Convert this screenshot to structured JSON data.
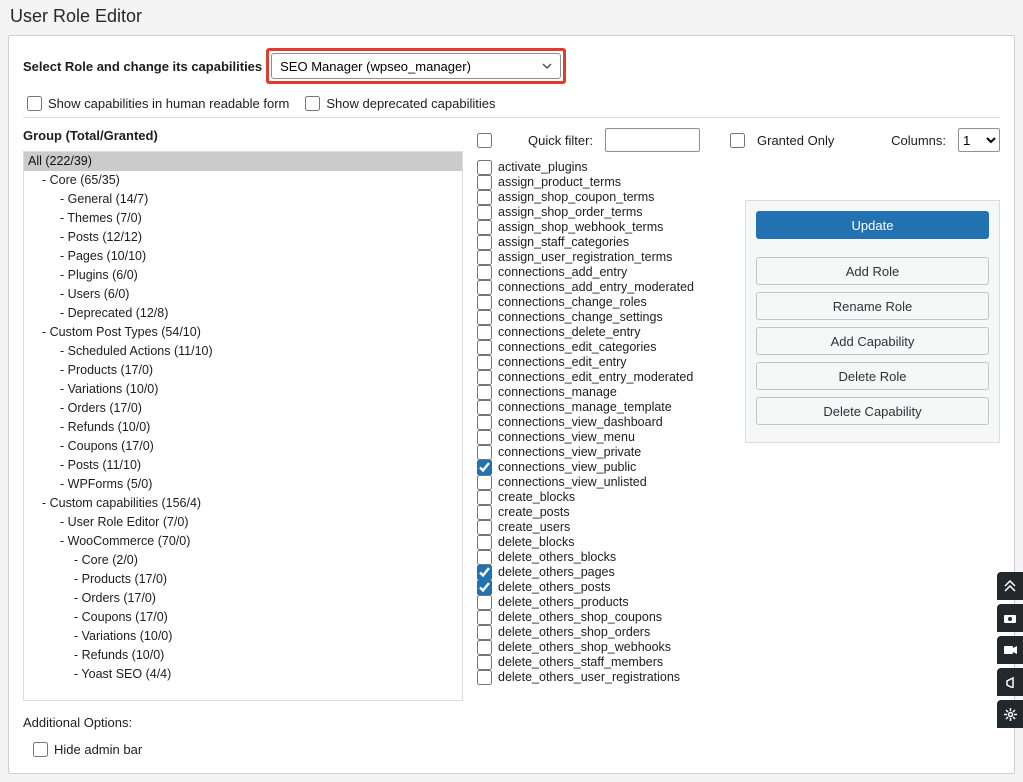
{
  "title": "User Role Editor",
  "role_label": "Select Role and change its capabilities",
  "role_selected": "SEO Manager (wpseo_manager)",
  "toggle_human": "Show capabilities in human readable form",
  "toggle_deprecated": "Show deprecated capabilities",
  "group_heading": "Group (Total/Granted)",
  "quick_filter_label": "Quick filter:",
  "granted_only_label": "Granted Only",
  "columns_label": "Columns:",
  "columns_value": "1",
  "additional_label": "Additional Options:",
  "hide_admin_bar_label": "Hide admin bar",
  "buttons": {
    "update": "Update",
    "add_role": "Add Role",
    "rename_role": "Rename Role",
    "add_capability": "Add Capability",
    "delete_role": "Delete Role",
    "delete_capability": "Delete Capability"
  },
  "groups": [
    {
      "label": "All (222/39)",
      "level": 0,
      "selected": true,
      "dash": false
    },
    {
      "label": "Core (65/35)",
      "level": 1,
      "dash": true
    },
    {
      "label": "General (14/7)",
      "level": 2,
      "dash": true
    },
    {
      "label": "Themes (7/0)",
      "level": 2,
      "dash": true
    },
    {
      "label": "Posts (12/12)",
      "level": 2,
      "dash": true
    },
    {
      "label": "Pages (10/10)",
      "level": 2,
      "dash": true
    },
    {
      "label": "Plugins (6/0)",
      "level": 2,
      "dash": true
    },
    {
      "label": "Users (6/0)",
      "level": 2,
      "dash": true
    },
    {
      "label": "Deprecated (12/8)",
      "level": 2,
      "dash": true
    },
    {
      "label": "Custom Post Types (54/10)",
      "level": 1,
      "dash": true
    },
    {
      "label": "Scheduled Actions (11/10)",
      "level": 2,
      "dash": true
    },
    {
      "label": "Products (17/0)",
      "level": 2,
      "dash": true
    },
    {
      "label": "Variations (10/0)",
      "level": 2,
      "dash": true
    },
    {
      "label": "Orders (17/0)",
      "level": 2,
      "dash": true
    },
    {
      "label": "Refunds (10/0)",
      "level": 2,
      "dash": true
    },
    {
      "label": "Coupons (17/0)",
      "level": 2,
      "dash": true
    },
    {
      "label": "Posts (11/10)",
      "level": 2,
      "dash": true
    },
    {
      "label": "WPForms (5/0)",
      "level": 2,
      "dash": true
    },
    {
      "label": "Custom capabilities (156/4)",
      "level": 1,
      "dash": true
    },
    {
      "label": "User Role Editor (7/0)",
      "level": 2,
      "dash": true
    },
    {
      "label": "WooCommerce (70/0)",
      "level": 2,
      "dash": true
    },
    {
      "label": "Core (2/0)",
      "level": 4,
      "dash": true
    },
    {
      "label": "Products (17/0)",
      "level": 4,
      "dash": true
    },
    {
      "label": "Orders (17/0)",
      "level": 4,
      "dash": true
    },
    {
      "label": "Coupons (17/0)",
      "level": 4,
      "dash": true
    },
    {
      "label": "Variations (10/0)",
      "level": 4,
      "dash": true
    },
    {
      "label": "Refunds (10/0)",
      "level": 4,
      "dash": true
    },
    {
      "label": "Yoast SEO (4/4)",
      "level": 4,
      "dash": true
    }
  ],
  "capabilities": [
    {
      "name": "activate_plugins",
      "checked": false
    },
    {
      "name": "assign_product_terms",
      "checked": false
    },
    {
      "name": "assign_shop_coupon_terms",
      "checked": false
    },
    {
      "name": "assign_shop_order_terms",
      "checked": false
    },
    {
      "name": "assign_shop_webhook_terms",
      "checked": false
    },
    {
      "name": "assign_staff_categories",
      "checked": false
    },
    {
      "name": "assign_user_registration_terms",
      "checked": false
    },
    {
      "name": "connections_add_entry",
      "checked": false
    },
    {
      "name": "connections_add_entry_moderated",
      "checked": false
    },
    {
      "name": "connections_change_roles",
      "checked": false
    },
    {
      "name": "connections_change_settings",
      "checked": false
    },
    {
      "name": "connections_delete_entry",
      "checked": false
    },
    {
      "name": "connections_edit_categories",
      "checked": false
    },
    {
      "name": "connections_edit_entry",
      "checked": false
    },
    {
      "name": "connections_edit_entry_moderated",
      "checked": false
    },
    {
      "name": "connections_manage",
      "checked": false
    },
    {
      "name": "connections_manage_template",
      "checked": false
    },
    {
      "name": "connections_view_dashboard",
      "checked": false
    },
    {
      "name": "connections_view_menu",
      "checked": false
    },
    {
      "name": "connections_view_private",
      "checked": false
    },
    {
      "name": "connections_view_public",
      "checked": true
    },
    {
      "name": "connections_view_unlisted",
      "checked": false
    },
    {
      "name": "create_blocks",
      "checked": false
    },
    {
      "name": "create_posts",
      "checked": false
    },
    {
      "name": "create_users",
      "checked": false
    },
    {
      "name": "delete_blocks",
      "checked": false
    },
    {
      "name": "delete_others_blocks",
      "checked": false
    },
    {
      "name": "delete_others_pages",
      "checked": true
    },
    {
      "name": "delete_others_posts",
      "checked": true
    },
    {
      "name": "delete_others_products",
      "checked": false
    },
    {
      "name": "delete_others_shop_coupons",
      "checked": false
    },
    {
      "name": "delete_others_shop_orders",
      "checked": false
    },
    {
      "name": "delete_others_shop_webhooks",
      "checked": false
    },
    {
      "name": "delete_others_staff_members",
      "checked": false
    },
    {
      "name": "delete_others_user_registrations",
      "checked": false
    }
  ]
}
